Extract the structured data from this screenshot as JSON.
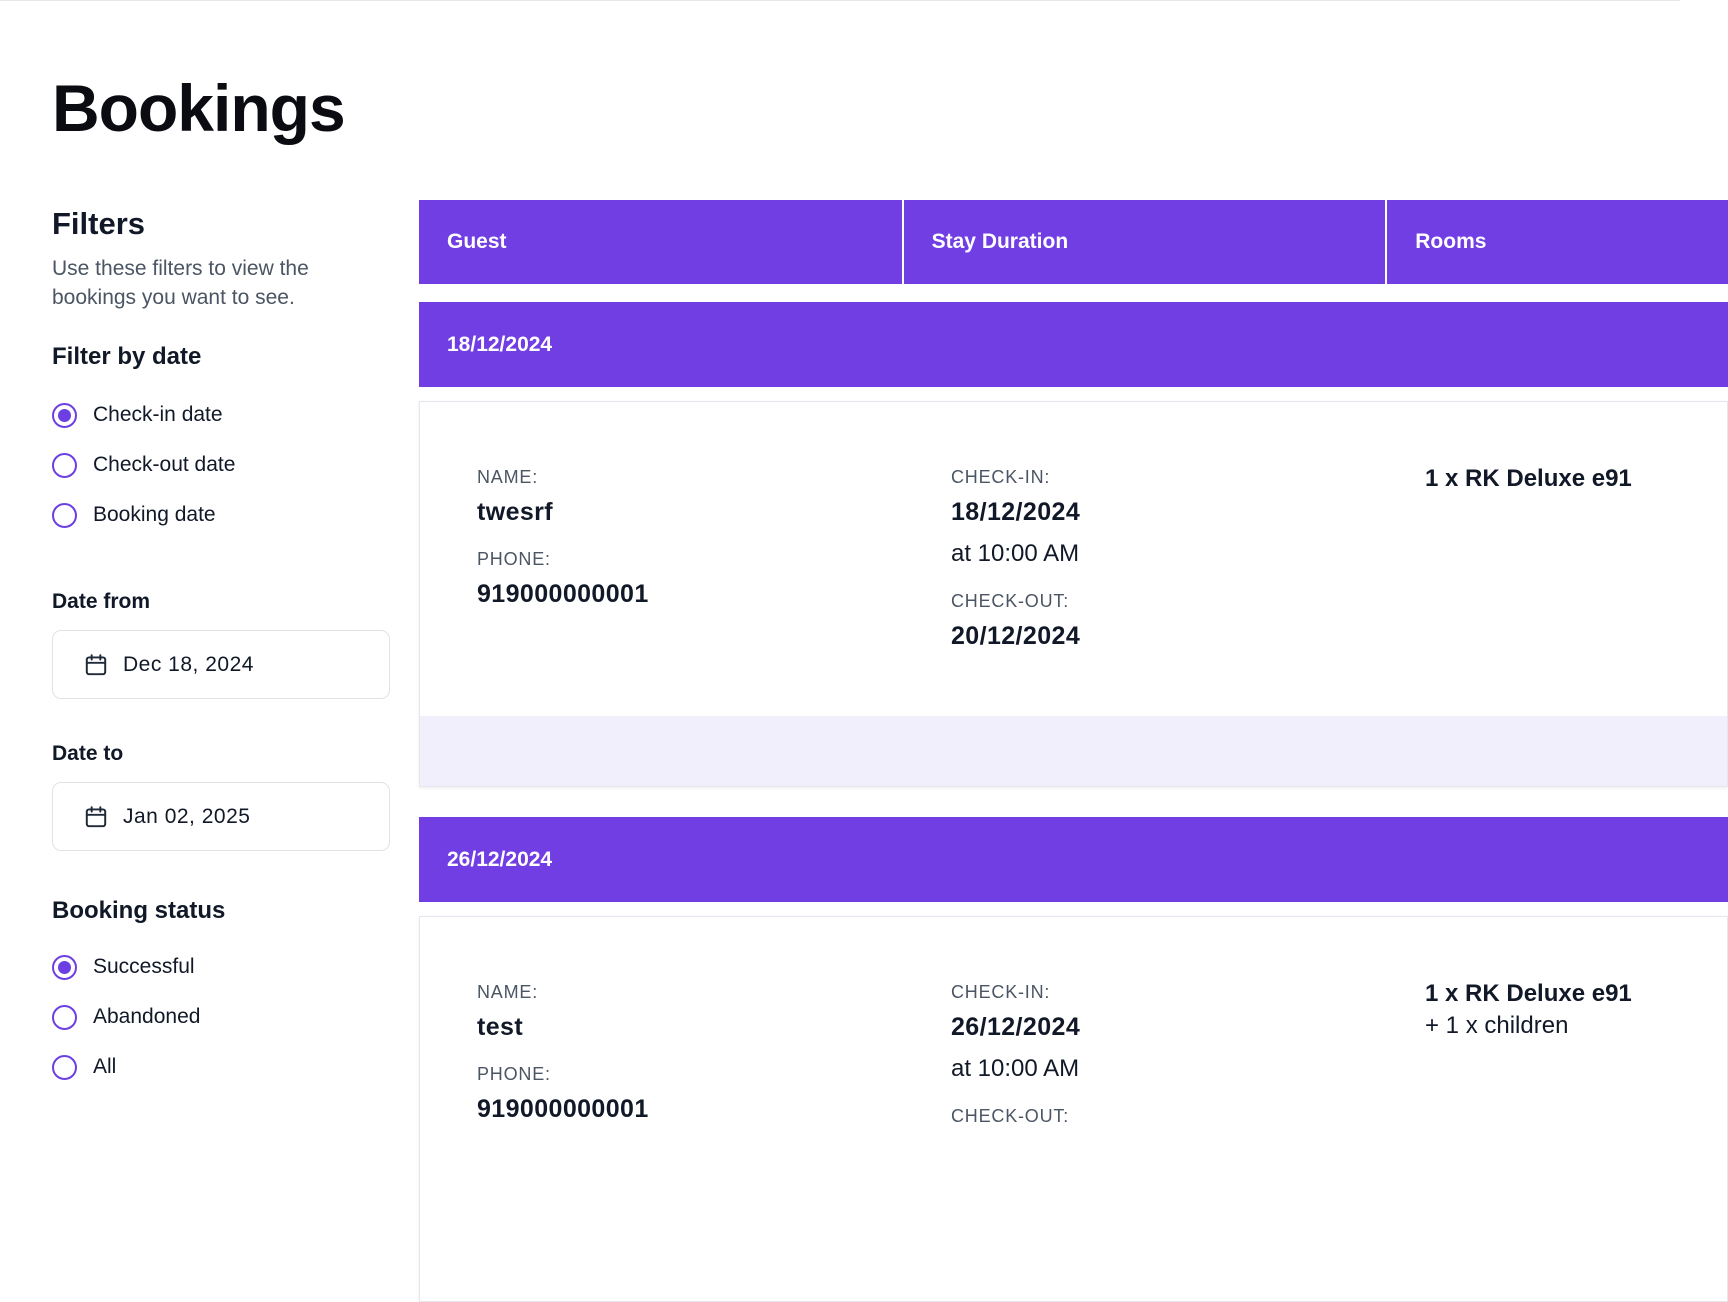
{
  "page": {
    "title": "Bookings"
  },
  "filters": {
    "heading": "Filters",
    "description": "Use these filters to view the bookings you want to see.",
    "filter_by_date": {
      "title": "Filter by date",
      "options": [
        {
          "label": "Check-in date",
          "checked": true
        },
        {
          "label": "Check-out date",
          "checked": false
        },
        {
          "label": "Booking date",
          "checked": false
        }
      ]
    },
    "date_from": {
      "label": "Date from",
      "value": "Dec 18, 2024",
      "icon": "calendar-icon"
    },
    "date_to": {
      "label": "Date to",
      "value": "Jan 02, 2025",
      "icon": "calendar-icon"
    },
    "booking_status": {
      "title": "Booking status",
      "options": [
        {
          "label": "Successful",
          "checked": true
        },
        {
          "label": "Abandoned",
          "checked": false
        },
        {
          "label": "All",
          "checked": false
        }
      ]
    }
  },
  "table": {
    "columns": [
      "Guest",
      "Stay Duration",
      "Rooms"
    ],
    "groups": [
      {
        "date": "18/12/2024",
        "bookings": [
          {
            "name_label": "NAME:",
            "name": "twesrf",
            "phone_label": "PHONE:",
            "phone": "919000000001",
            "checkin_label": "CHECK-IN:",
            "checkin_date": "18/12/2024",
            "checkin_time": "at 10:00 AM",
            "checkout_label": "CHECK-OUT:",
            "checkout_date": "20/12/2024",
            "room": "1 x RK Deluxe e91",
            "extra": ""
          }
        ]
      },
      {
        "date": "26/12/2024",
        "bookings": [
          {
            "name_label": "NAME:",
            "name": "test",
            "phone_label": "PHONE:",
            "phone": "919000000001",
            "checkin_label": "CHECK-IN:",
            "checkin_date": "26/12/2024",
            "checkin_time": "at 10:00 AM",
            "checkout_label": "CHECK-OUT:",
            "room": "1 x RK Deluxe e91",
            "extra": "+ 1 x children"
          }
        ]
      }
    ]
  },
  "colors": {
    "accent": "#703ee3",
    "radio": "#6d3fe3",
    "card_footer": "#f1effc"
  }
}
